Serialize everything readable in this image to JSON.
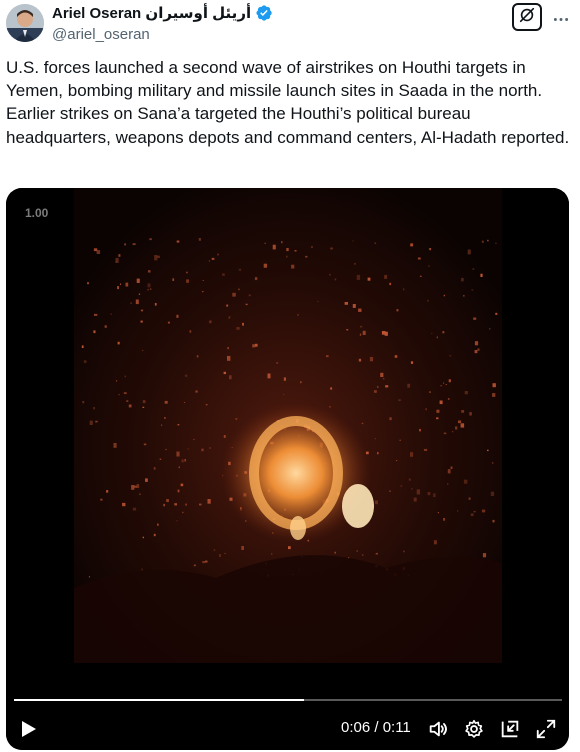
{
  "author": {
    "display_name": "Ariel Oseran أريئل أوسيران",
    "handle": "@ariel_oseran",
    "verified": true
  },
  "icons": {
    "avatar": "profile-photo",
    "verified": "verified-badge-icon",
    "grok": "grok-icon",
    "more": "more-icon",
    "play": "play-icon",
    "volume": "volume-icon",
    "settings": "gear-icon",
    "pip": "picture-in-picture-icon",
    "fullscreen": "fullscreen-icon"
  },
  "tweet": {
    "text": "U.S. forces launched a second wave of airstrikes on Houthi targets in Yemen, bombing military and missile launch sites in Saada in the north. Earlier strikes on Sana’a targeted the Houthi’s political bureau headquarters, weapons depots and command centers, Al-Hadath reported."
  },
  "video": {
    "playback_rate": "1.00",
    "time": "0:06 / 0:11",
    "progress_fraction": 0.53
  },
  "colors": {
    "verified_blue": "#1d9bf0",
    "text_primary": "#0f1419",
    "text_secondary": "#536471",
    "fire_orange": "#ff8a2a"
  }
}
